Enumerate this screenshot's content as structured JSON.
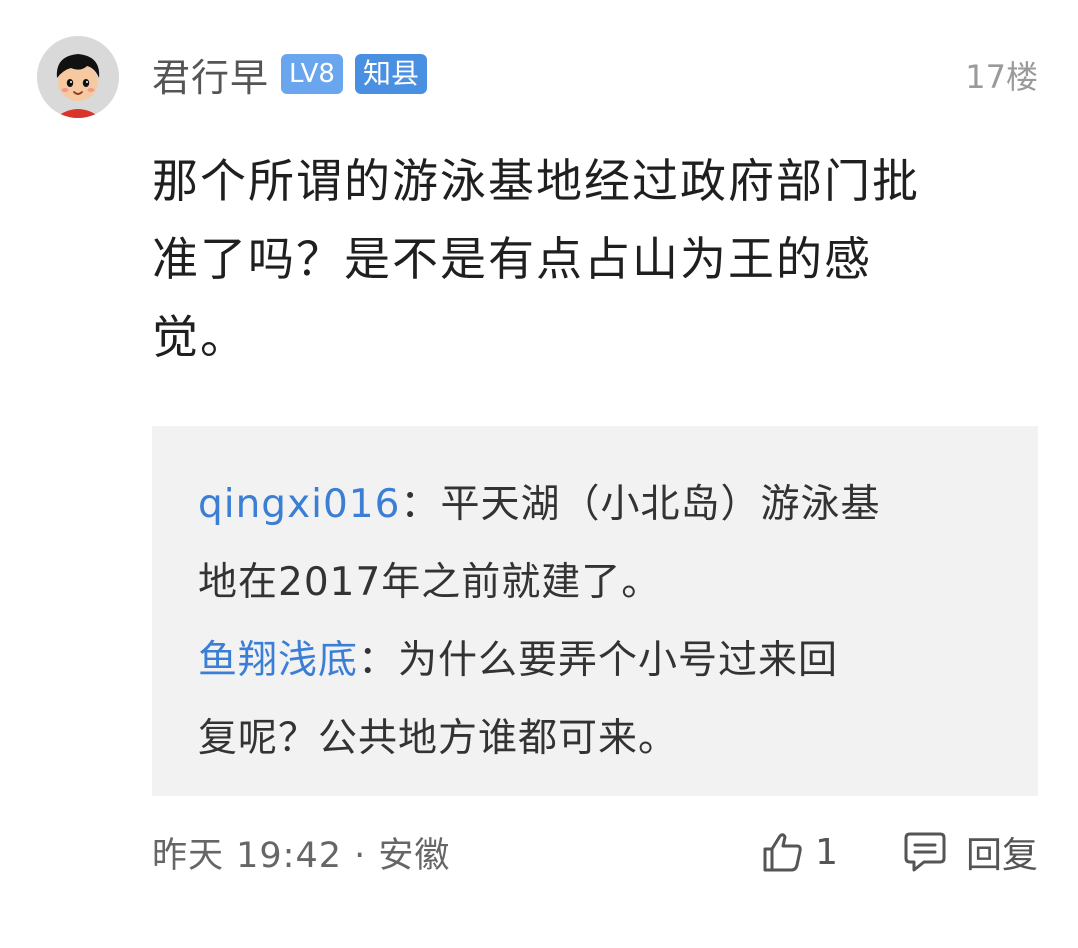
{
  "post": {
    "username": "君行早",
    "level_badge": "LV8",
    "title_badge": "知县",
    "floor": "17楼",
    "content_lines": [
      "那个所谓的游泳基地经过政府部门批",
      "准了吗？是不是有点占山为王的感",
      "觉。"
    ],
    "avatar_icon": "cartoon-boy-avatar"
  },
  "replies": [
    {
      "author": "qingxi016",
      "separator": "：",
      "line1": "平天湖（小北岛）游泳基",
      "line2": "地在2017年之前就建了。"
    },
    {
      "author": "鱼翔浅底",
      "separator": "：",
      "line1": "为什么要弄个小号过来回",
      "line2": "复呢？公共地方谁都可来。"
    }
  ],
  "footer": {
    "meta": "昨天 19:42 · 安徽",
    "like_count": "1",
    "reply_label": "回复",
    "like_icon": "thumbs-up-icon",
    "reply_icon": "comment-icon"
  },
  "colors": {
    "username": "#555555",
    "badge": "#4a90e2",
    "reply_author": "#3a7fd5",
    "reply_bg": "#f2f2f2"
  }
}
